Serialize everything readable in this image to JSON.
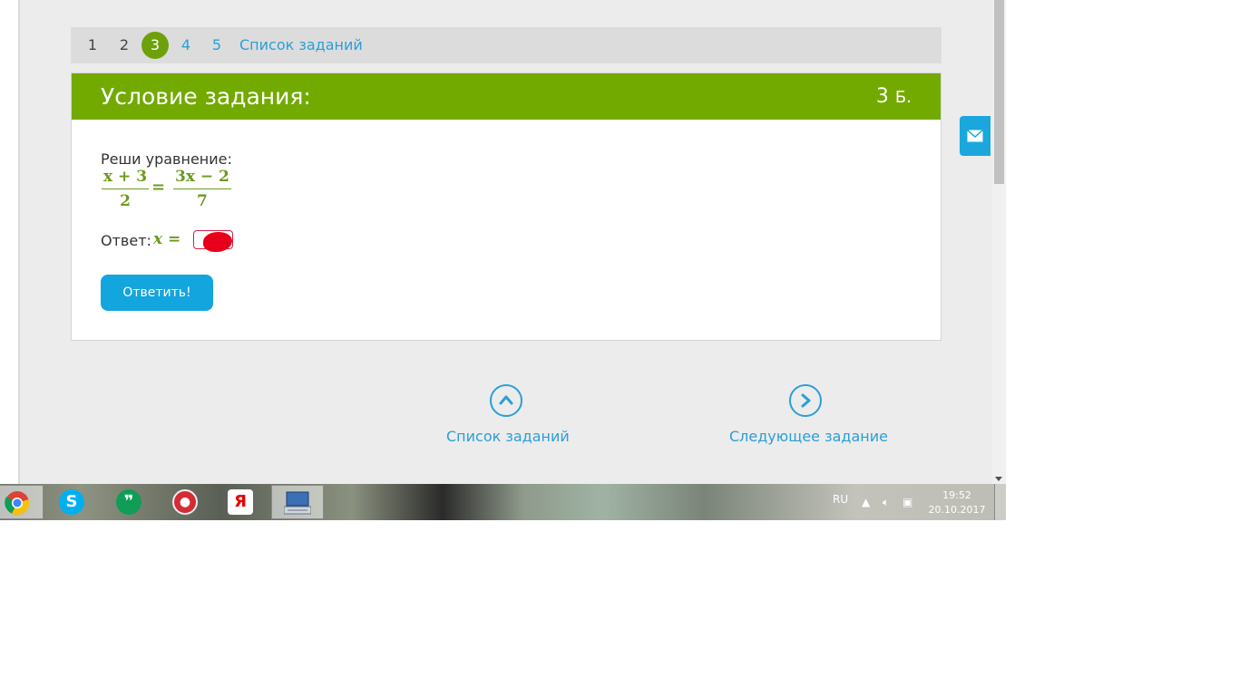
{
  "pagination": {
    "items": [
      "1",
      "2",
      "3",
      "4",
      "5"
    ],
    "current": "3",
    "task_list_link": "Список заданий"
  },
  "task": {
    "title": "Условие задания:",
    "score_value": "3",
    "score_unit": "Б.",
    "prompt": "Реши уравнение:",
    "equation": {
      "left_num": "x + 3",
      "left_den": "2",
      "equals": "=",
      "right_num": "3x − 2",
      "right_den": "7"
    },
    "answer_label": "Ответ:",
    "answer_var": "x =",
    "answer_value": "",
    "submit_label": "Ответить!"
  },
  "bottom_nav": {
    "list_label": "Список заданий",
    "list_icon": "chevron-up-icon",
    "next_label": "Следующее задание",
    "next_icon": "chevron-right-icon"
  },
  "feedback": {
    "icon": "mail-icon"
  },
  "taskbar": {
    "apps": [
      {
        "name": "chrome",
        "active": true
      },
      {
        "name": "skype",
        "glyph": "S"
      },
      {
        "name": "hangouts",
        "glyph": "❞"
      },
      {
        "name": "media-player",
        "glyph": "●"
      },
      {
        "name": "yandex-browser",
        "glyph": "Я"
      },
      {
        "name": "on-screen-keyboard",
        "active": true
      }
    ],
    "language": "RU",
    "time": "19:52",
    "date": "20.10.2017"
  },
  "colors": {
    "accent_green": "#72aa00",
    "link_blue": "#2a9fd6",
    "button_blue": "#13a5de"
  }
}
